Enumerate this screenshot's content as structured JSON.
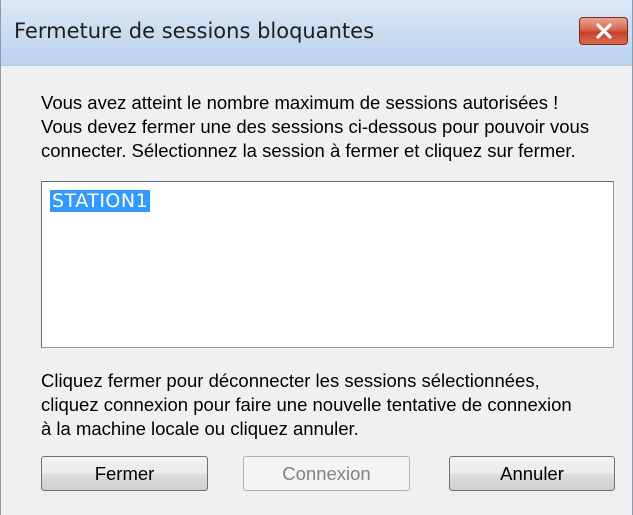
{
  "window": {
    "title": "Fermeture de sessions bloquantes",
    "close_icon": "close-x-icon"
  },
  "message": {
    "lines": [
      "Vous avez atteint le nombre maximum de sessions autorisées !",
      "Vous devez fermer une des sessions ci-dessous pour pouvoir vous",
      "connecter. Sélectionnez la session à fermer et cliquez sur fermer."
    ]
  },
  "sessions": {
    "items": [
      "STATION1"
    ],
    "selected": "STATION1"
  },
  "instructions": {
    "lines": [
      "Cliquez fermer pour déconnecter les sessions sélectionnées,",
      "cliquez connexion pour faire une nouvelle tentative de connexion",
      "à la machine locale ou cliquez annuler."
    ]
  },
  "buttons": {
    "fermer": "Fermer",
    "connexion": "Connexion",
    "annuler": "Annuler"
  },
  "colors": {
    "selection": "#3399ff",
    "close_button": "#c7402a",
    "title_bar": "#c9dcf1"
  }
}
